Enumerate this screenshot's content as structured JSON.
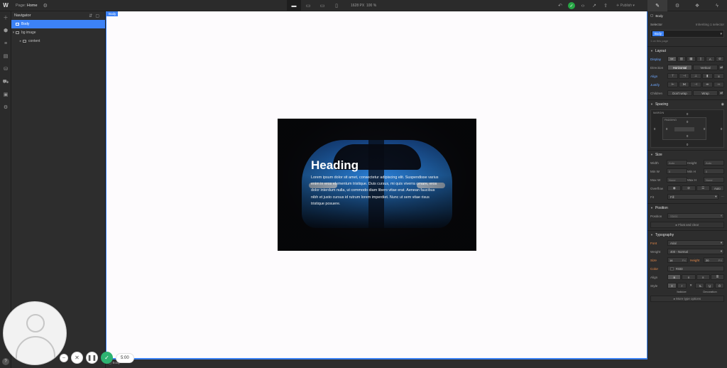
{
  "topbar": {
    "logo": "W",
    "page_label": "Page:",
    "page_name": "Home",
    "viewport_width": "1628 PX",
    "zoom": "100 %",
    "publish_label": "Publish"
  },
  "navigator": {
    "title": "Navigator",
    "items": [
      {
        "label": "Body"
      },
      {
        "label": "bg image"
      },
      {
        "label": "content"
      }
    ]
  },
  "canvas": {
    "body_tag": "Body",
    "hero": {
      "heading": "Heading",
      "paragraph": "Lorem ipsum dolor sit amet, consectetur adipiscing elit. Suspendisse varius enim in eros elementum tristique. Duis cursus, mi quis viverra ornare, eros dolor interdum nulla, ut commodo diam libero vitae erat. Aenean faucibus nibh et justo cursus id rutrum lorem imperdiet. Nunc ut sem vitae risus tristique posuere."
    }
  },
  "style_panel": {
    "element": "Body",
    "selector_label": "Selector",
    "inheriting_label": "Inheriting 1 selector",
    "selector_chip": "Body",
    "on_page_note": "1 on this page",
    "layout": {
      "title": "Layout",
      "display_label": "Display",
      "direction_label": "Direction",
      "horizontal": "Horizontal",
      "vertical": "Vertical",
      "align_label": "Align",
      "justify_label": "Justify",
      "children_label": "Children",
      "dont_wrap": "Don't wrap",
      "wrap": "Wrap"
    },
    "spacing": {
      "title": "Spacing",
      "margin_label": "MARGIN",
      "padding_label": "PADDING",
      "values": [
        "0",
        "0",
        "0",
        "0",
        "0",
        "0",
        "0",
        "0"
      ]
    },
    "size": {
      "title": "Size",
      "width_label": "Width",
      "height_label": "Height",
      "min_w_label": "Min W",
      "min_h_label": "Min H",
      "max_w_label": "Max W",
      "max_h_label": "Max H",
      "auto": "Auto",
      "zero": "0",
      "none": "None",
      "overflow_label": "Overflow",
      "overflow_auto": "Auto",
      "fit_label": "Fit",
      "fit_value": "Fill"
    },
    "position": {
      "title": "Position",
      "position_label": "Position",
      "position_value": "Static",
      "float_clear": "Float and clear"
    },
    "typography": {
      "title": "Typography",
      "font_label": "Font",
      "font_value": "Arial",
      "weight_label": "Weight",
      "weight_value": "400 - Normal",
      "size_label": "Size",
      "size_value": "14",
      "size_unit": "PX",
      "height_label": "Height",
      "height_value": "20",
      "height_unit": "PX",
      "color_label": "Color",
      "color_value": "#333",
      "align_label": "Align",
      "style_label": "Style",
      "italicize": "Italicize",
      "decoration": "Decoration",
      "more_type": "More type options"
    }
  },
  "recorder": {
    "timer": "5:00"
  },
  "colors": {
    "accent": "#3c82f6",
    "canvas_bg": "#fdfbfd",
    "panel_bg": "#2d2d2d",
    "publish_ok": "#27a745"
  },
  "icons": [
    "webflow-logo",
    "settings-icon",
    "desktop-icon",
    "tablet-icon",
    "mobile-landscape-icon",
    "mobile-portrait-icon",
    "undo-icon",
    "check-icon",
    "code-icon",
    "export-icon",
    "share-icon",
    "publish-icon",
    "brush-icon",
    "gear-icon",
    "interactions-icon",
    "lightning-icon",
    "add-icon",
    "components-icon",
    "navigator-icon",
    "pages-icon",
    "cms-icon",
    "ecommerce-icon",
    "assets-icon",
    "settings-gear-icon",
    "help-icon"
  ]
}
